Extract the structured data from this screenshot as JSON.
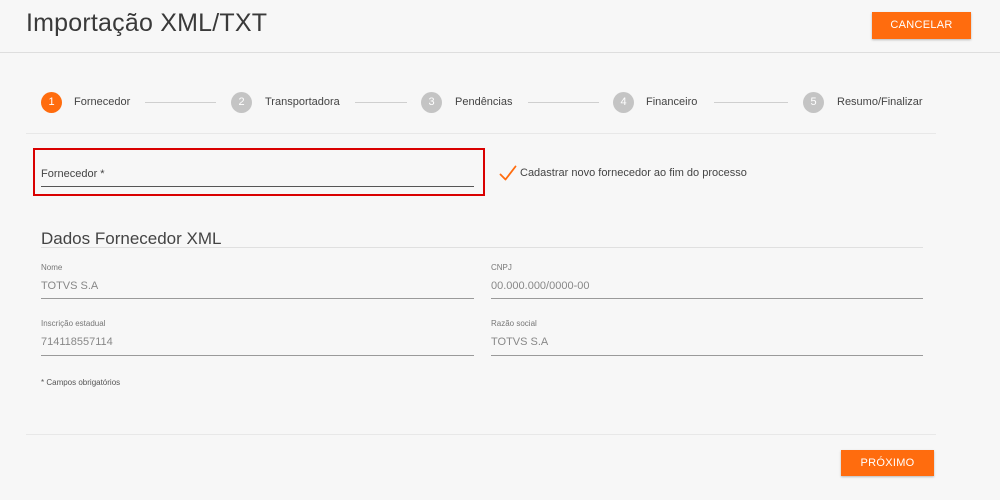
{
  "header": {
    "title": "Importação XML/TXT",
    "cancel_label": "CANCELAR"
  },
  "stepper": {
    "steps": [
      {
        "number": "1",
        "label": "Fornecedor"
      },
      {
        "number": "2",
        "label": "Transportadora"
      },
      {
        "number": "3",
        "label": "Pendências"
      },
      {
        "number": "4",
        "label": "Financeiro"
      },
      {
        "number": "5",
        "label": "Resumo/Finalizar"
      }
    ]
  },
  "form": {
    "fornecedor_label": "Fornecedor *",
    "register_new_label": "Cadastrar novo fornecedor ao fim do processo",
    "register_new_checked": true
  },
  "xml_section": {
    "title": "Dados Fornecedor XML",
    "fields": {
      "nome": {
        "label": "Nome",
        "value": "TOTVS S.A"
      },
      "cnpj": {
        "label": "CNPJ",
        "value": "00.000.000/0000-00"
      },
      "inscricao": {
        "label": "Inscrição estadual",
        "value": "714118557114"
      },
      "razao": {
        "label": "Razão social",
        "value": "TOTVS S.A"
      }
    }
  },
  "footer": {
    "required_note": "* Campos obrigatórios",
    "next_label": "PRÓXIMO"
  },
  "colors": {
    "accent": "#ff6c0e",
    "step_inactive": "#c4c4c4",
    "highlight": "#d90000"
  }
}
